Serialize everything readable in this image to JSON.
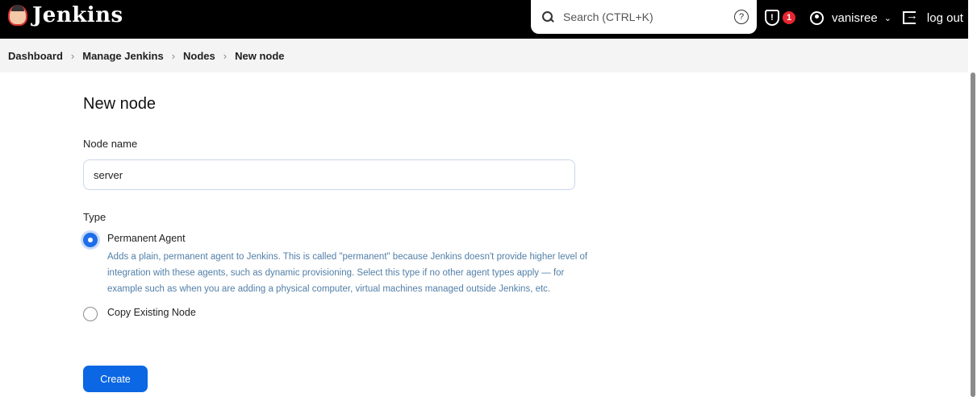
{
  "header": {
    "logo_text": "Jenkins",
    "search_placeholder": "Search (CTRL+K)",
    "help_icon": "?",
    "security_badge": "1",
    "username": "vanisree",
    "logout_label": "log out"
  },
  "breadcrumb": [
    "Dashboard",
    "Manage Jenkins",
    "Nodes",
    "New node"
  ],
  "main": {
    "title": "New node",
    "node_name_label": "Node name",
    "node_name_value": "server",
    "type_label": "Type",
    "options": [
      {
        "label": "Permanent Agent",
        "selected": true,
        "description": "Adds a plain, permanent agent to Jenkins. This is called \"permanent\" because Jenkins doesn't provide higher level of integration with these agents, such as dynamic provisioning. Select this type if no other agent types apply — for example such as when you are adding a physical computer, virtual machines managed outside Jenkins, etc."
      },
      {
        "label": "Copy Existing Node",
        "selected": false
      }
    ],
    "create_label": "Create"
  },
  "colors": {
    "header_bg": "#000000",
    "accent": "#0b67e3",
    "badge": "#e6262e",
    "description": "#527fa8"
  }
}
